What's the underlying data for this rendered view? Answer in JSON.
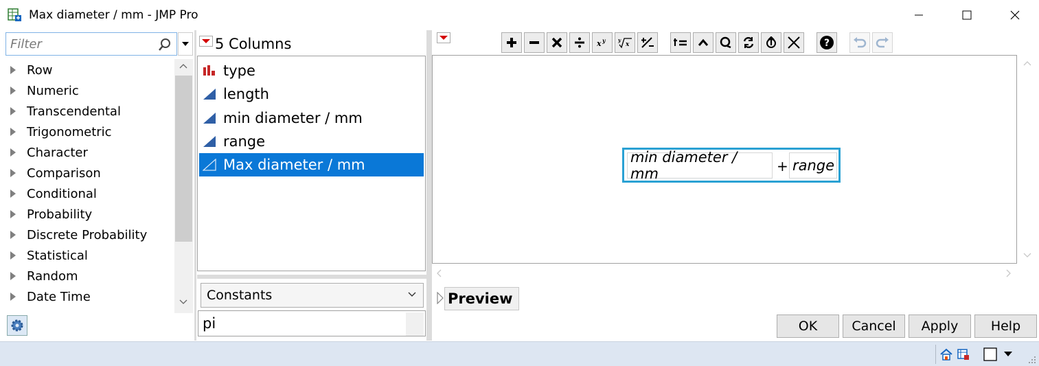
{
  "window": {
    "title": "Max diameter / mm - JMP Pro",
    "minimize_icon": "minimize-icon",
    "maximize_icon": "maximize-icon",
    "close_icon": "close-icon"
  },
  "filter": {
    "placeholder": "Filter"
  },
  "functions": {
    "items": [
      {
        "label": "Row"
      },
      {
        "label": "Numeric"
      },
      {
        "label": "Transcendental"
      },
      {
        "label": "Trigonometric"
      },
      {
        "label": "Character"
      },
      {
        "label": "Comparison"
      },
      {
        "label": "Conditional"
      },
      {
        "label": "Probability"
      },
      {
        "label": "Discrete Probability"
      },
      {
        "label": "Statistical"
      },
      {
        "label": "Random"
      },
      {
        "label": "Date Time"
      }
    ]
  },
  "columns": {
    "header": "5 Columns",
    "items": [
      {
        "label": "type",
        "kind": "nominal",
        "selected": false
      },
      {
        "label": "length",
        "kind": "continuous",
        "selected": false
      },
      {
        "label": "min diameter / mm",
        "kind": "continuous",
        "selected": false
      },
      {
        "label": "range",
        "kind": "continuous",
        "selected": false
      },
      {
        "label": "Max diameter / mm",
        "kind": "formula",
        "selected": true
      }
    ]
  },
  "constants": {
    "selected": "Constants",
    "value": "pi"
  },
  "formula": {
    "left_term": "min diameter / mm",
    "operator": "+",
    "right_term": "range"
  },
  "preview": {
    "label": "Preview"
  },
  "buttons": {
    "ok": "OK",
    "cancel": "Cancel",
    "apply": "Apply",
    "help": "Help"
  },
  "colors": {
    "selection": "#0a78d7",
    "formula_border": "#2aa1d3",
    "menu_triangle": "#d40000",
    "statusbar": "#dde6f2"
  }
}
